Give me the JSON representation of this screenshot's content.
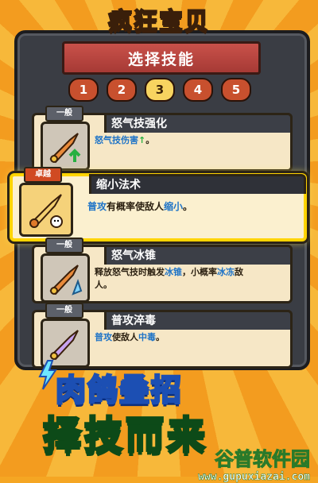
{
  "title": "疯狂宝贝",
  "dialog": {
    "ribbon_title": "选择技能",
    "steps": [
      "1",
      "2",
      "3",
      "4",
      "5"
    ],
    "active_step": 3
  },
  "skills": [
    {
      "tag": "一般",
      "name": "怒气技强化",
      "desc_parts": [
        "怒气技伤害",
        "↑",
        "。"
      ],
      "icon": "sword-up-icon",
      "selected": false
    },
    {
      "tag": "卓越",
      "name": "缩小法术",
      "desc_parts": [
        "普攻",
        "有概率使敌人",
        "缩小",
        "。"
      ],
      "icon": "sword-shrink-icon",
      "selected": true
    },
    {
      "tag": "一般",
      "name": "怒气冰锥",
      "desc_line1": [
        "释放怒气技时触发",
        "冰锥",
        "，小概率",
        "冰冻",
        "敌"
      ],
      "desc_line2": "人。",
      "icon": "ice-shard-icon",
      "selected": false
    },
    {
      "tag": "一般",
      "name": "普攻淬毒",
      "desc_parts": [
        "普攻",
        "使敌人",
        "中毒",
        "。"
      ],
      "icon": "poison-blade-icon",
      "selected": false
    }
  ],
  "promo": {
    "line1": "肉鸽叠招",
    "line2": "择技而来"
  },
  "watermark": {
    "cn": "谷普软件园",
    "url": "www.gupuxiazai.com"
  },
  "colors": {
    "keyword": "#1d73c7",
    "selected_border": "#ffd400"
  }
}
